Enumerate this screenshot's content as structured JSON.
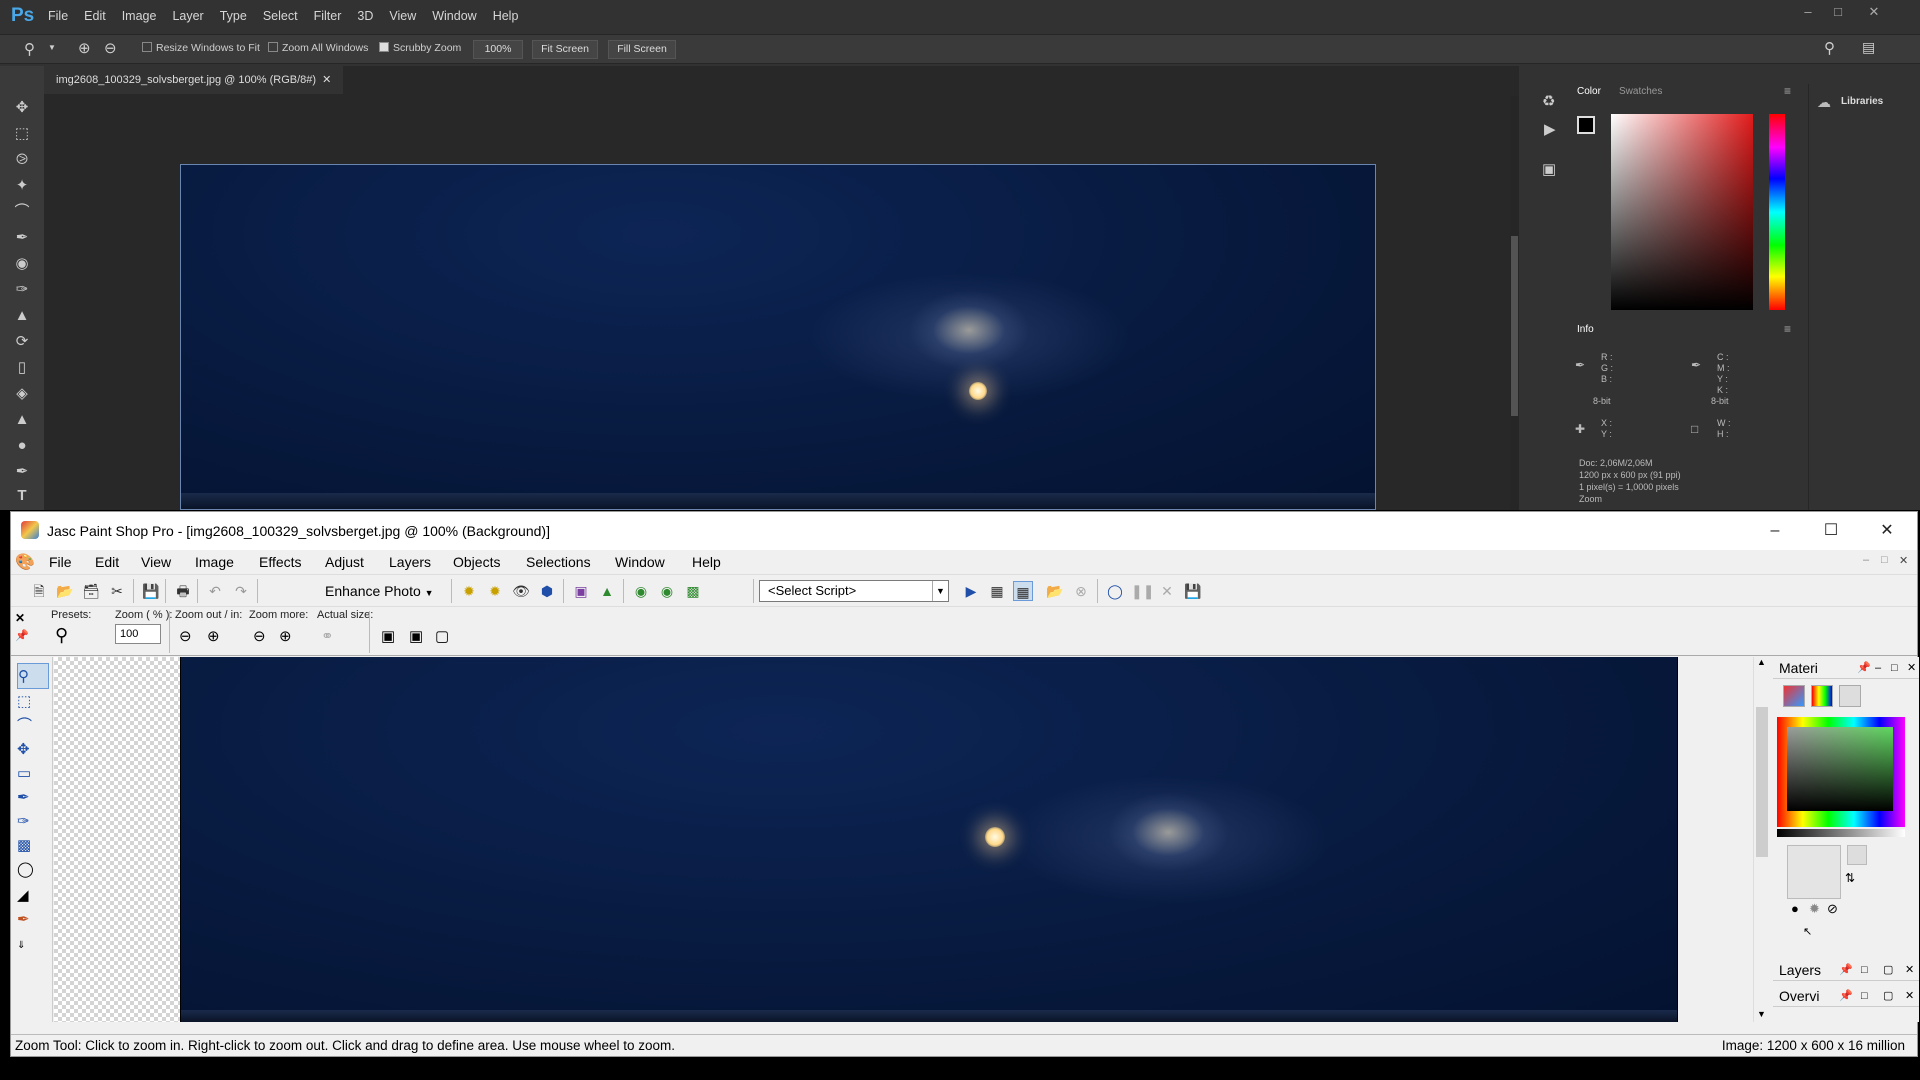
{
  "ps": {
    "logo": "Ps",
    "menu": [
      "File",
      "Edit",
      "Image",
      "Layer",
      "Type",
      "Select",
      "Filter",
      "3D",
      "View",
      "Window",
      "Help"
    ],
    "options": {
      "resize_windows": "Resize Windows to Fit",
      "zoom_all": "Zoom All Windows",
      "scrubby": "Scrubby Zoom",
      "zoom_pct": "100%",
      "fit_screen": "Fit Screen",
      "fill_screen": "Fill Screen"
    },
    "doc_tab": "img2608_100329_solvsberget.jpg @ 100% (RGB/8#)",
    "panels": {
      "color_tab": "Color",
      "swatches_tab": "Swatches",
      "info_tab": "Info",
      "libraries": "Libraries"
    },
    "info": {
      "rgb": "R :\nG :\nB :",
      "cmyk": "C :\nM :\nY :\nK :",
      "bit1": "8-bit",
      "bit2": "8-bit",
      "xy": "X :\nY :",
      "wh": "W :\nH :",
      "doc": "Doc: 2,06M/2,06M",
      "size": "1200 px x 600 px (91 ppi)",
      "pixels": "1 pixel(s) = 1,0000 pixels",
      "zoom": "Zoom"
    }
  },
  "psp": {
    "title": "Jasc Paint Shop Pro - [img2608_100329_solvsberget.jpg @ 100% (Background)]",
    "menu": [
      "File",
      "View",
      "Image",
      "Effects",
      "Adjust",
      "Layers",
      "Objects",
      "Selections",
      "Window",
      "Help"
    ],
    "menu_edit": "Edit",
    "enhance": "Enhance Photo",
    "script": "<Select Script>",
    "labels": {
      "presets": "Presets:",
      "zoom": "Zoom ( % ):",
      "zoomout": "Zoom out / in:",
      "zoommore": "Zoom more:",
      "actual": "Actual size:"
    },
    "zoom_value": "100",
    "panels": {
      "materials": "Materi",
      "layers": "Layers",
      "overview": "Overvi"
    },
    "status": "Zoom Tool: Click to zoom in. Right-click to zoom out. Click and drag to define area. Use mouse wheel to zoom.",
    "image_info": "Image:  1200 x 600 x 16 million"
  }
}
